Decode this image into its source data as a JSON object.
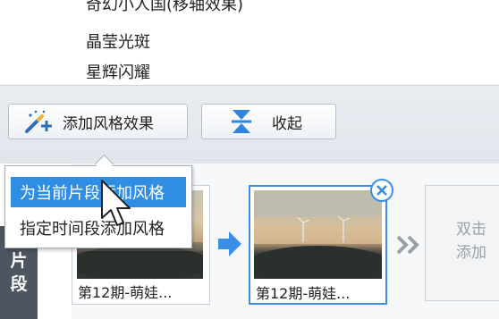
{
  "effects": {
    "items": [
      "奇幻小人国(移轴效果)",
      "晶莹光斑",
      "星辉闪耀"
    ]
  },
  "toolbar": {
    "add_style_label": "添加风格效果",
    "collapse_label": "收起"
  },
  "popup_menu": {
    "items": [
      "为当前片段添加风格",
      "指定时间段添加风格"
    ]
  },
  "side_tab": {
    "chars": [
      "片",
      "段"
    ]
  },
  "clips": [
    {
      "caption": "第12期-萌娃..."
    },
    {
      "caption": "第12期-萌娃..."
    }
  ],
  "add_slot": {
    "line1": "双击",
    "line2": "添加"
  },
  "icons": {
    "add_style": "magic-wand-plus-icon",
    "collapse": "hourglass-collapse-icon",
    "next": "arrow-right-icon",
    "more": "double-chevron-right-icon",
    "remove": "close-icon",
    "pointer": "mouse-cursor-icon"
  },
  "colors": {
    "accent": "#2f8ee4",
    "selected_border": "#3a8ee6",
    "side_tab": "#4d5560"
  }
}
